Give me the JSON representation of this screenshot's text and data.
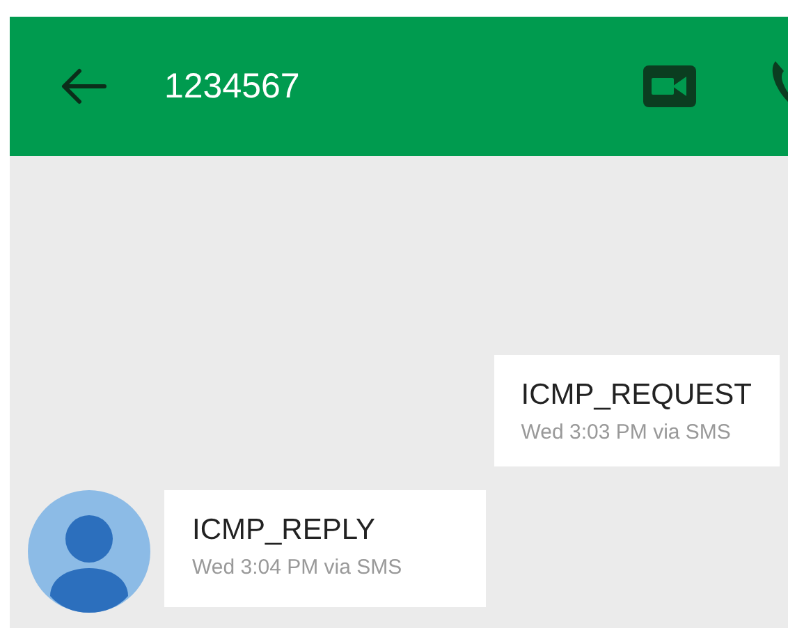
{
  "header": {
    "title": "1234567"
  },
  "messages": [
    {
      "kind": "outgoing",
      "text": "ICMP_REQUEST",
      "meta": "Wed 3:03 PM via SMS"
    },
    {
      "kind": "incoming",
      "text": "ICMP_REPLY",
      "meta": "Wed 3:04 PM via SMS"
    }
  ]
}
